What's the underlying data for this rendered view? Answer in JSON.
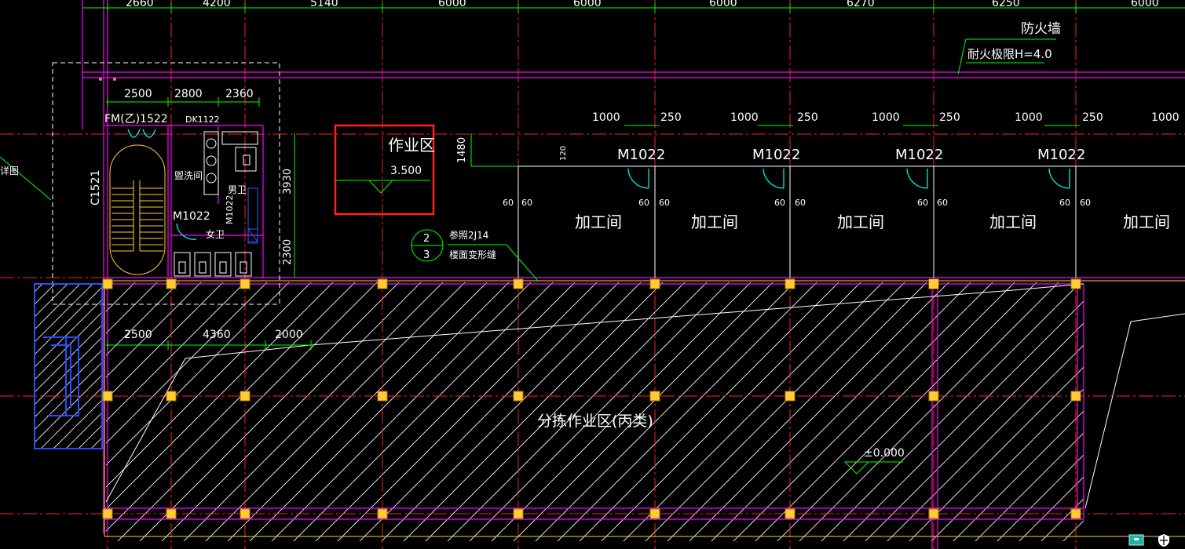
{
  "top_dims": [
    "2660",
    "4200",
    "5140",
    "6000",
    "6000",
    "6000",
    "6270",
    "6250",
    "6000"
  ],
  "stair_dims": [
    "2500",
    "2800",
    "2360"
  ],
  "lower_dims": [
    "2500",
    "4360",
    "2000"
  ],
  "room_dims": [
    "1000",
    "250",
    "1000",
    "250",
    "1000",
    "250",
    "1000",
    "250",
    "1000"
  ],
  "firewall": {
    "label": "防火墙",
    "rating": "耐火极限H=4.0"
  },
  "rooms": {
    "fm": "FM(乙)1522",
    "dk": "DK1122",
    "c1521": "C1521",
    "wash": "盥洗间",
    "male": "男卫",
    "female": "女卫",
    "m1022_small": "M1022",
    "m1022_rot": "M1022",
    "side_detail": "详图"
  },
  "work_zone": {
    "title": "作业区",
    "elev": "3.500"
  },
  "dim_1480": "1480",
  "dim_3930": "3930",
  "dim_2300": "2300",
  "dim_120": "120",
  "sixty": "60",
  "door_labels": [
    "M1022",
    "M1022",
    "M1022",
    "M1022"
  ],
  "workshops": [
    "加工间",
    "加工间",
    "加工间",
    "加工间",
    "加工间"
  ],
  "ref_note": {
    "top": "2",
    "bottom": "3",
    "line1": "参照2J14",
    "line2": "楼面变形缝"
  },
  "sort_zone": "分拣作业区(丙类)",
  "ground_elev": "±0.000",
  "colors": {
    "axis": "#ff2020",
    "dim": "#00ff00",
    "wall": "#ff00ff",
    "hatch": "#ffffff",
    "column": "#ffcc33",
    "highlight": "#ff2020",
    "stair_blue": "#2050ff"
  },
  "icons": [
    "taskbar-app-icon",
    "taskbar-shield-icon"
  ]
}
